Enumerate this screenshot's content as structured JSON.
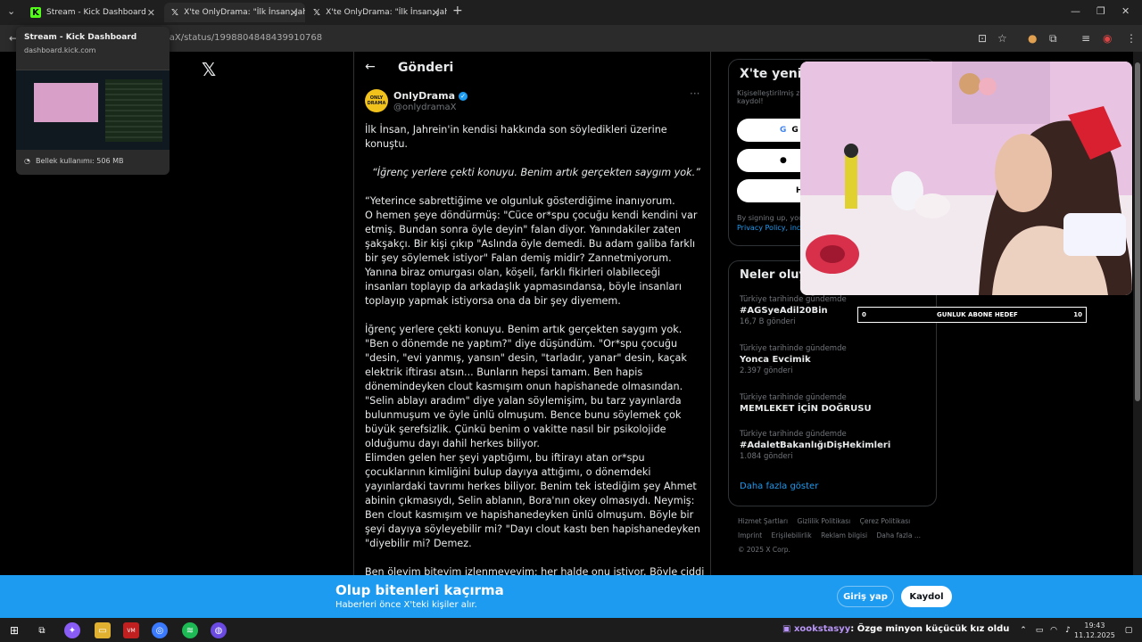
{
  "browser": {
    "tabs": [
      {
        "title": "Stream - Kick Dashboard",
        "icon": "kick-icon"
      },
      {
        "title": "X'te OnlyDrama: \"İlk İnsan, Jahr",
        "icon": "x-icon"
      },
      {
        "title": "X'te OnlyDrama: \"İlk İnsan, Jahr",
        "icon": "x-icon"
      }
    ],
    "url": "maX/status/1998804848439910768",
    "hover_card": {
      "title": "Stream - Kick Dashboard",
      "domain": "dashboard.kick.com",
      "memory": "Bellek kullanımı: 506 MB"
    }
  },
  "page": {
    "header_title": "Gönderi",
    "post": {
      "avatar_text": "ONLY DRAMA",
      "author": "OnlyDrama",
      "handle": "@onlydramaX",
      "intro": "İlk İnsan, Jahrein'in kendisi hakkında son söyledikleri üzerine konuştu.",
      "quote": "“İğrenç yerlere çekti konuyu. Benim artık gerçekten saygım yok.”",
      "para1": "“Yeterince sabrettiğime ve olgunluk gösterdiğime inanıyorum.\nO hemen şeye döndürmüş: \"Cüce or*spu çocuğu kendi kendini var etmiş. Bundan sonra öyle deyin\" falan diyor. Yanındakiler zaten şakşakçı. Bir kişi çıkıp \"Aslında öyle demedi. Bu adam galiba farklı bir şey söylemek istiyor\" Falan demiş midir? Zannetmiyorum. Yanına biraz omurgası olan, köşeli, farklı fikirleri olabileceği insanları toplayıp da arkadaşlık yapmasındansa, böyle insanları toplayıp yapmak istiyorsa ona da bir şey diyemem.",
      "para2": "İğrenç yerlere çekti konuyu. Benim artık gerçekten saygım yok. \"Ben o dönemde ne yaptım?\" diye düşündüm. \"Or*spu çocuğu \"desin, \"evi yanmış, yansın\" desin, \"tarladır, yanar\" desin, kaçak elektrik iftirası atsın... Bunların hepsi tamam. Ben hapis dönemindeyken clout kasmışım onun hapishanede olmasından. \"Selin ablayı aradım\" diye yalan söylemişim, bu tarz yayınlarda bulunmuşum ve öyle ünlü olmuşum. Bence bunu söylemek çok büyük şerefsizlik. Çünkü benim o vakitte nasıl bir psikolojide olduğumu dayı dahil herkes biliyor.\nElimden gelen her şeyi yaptığımı, bu iftirayı atan or*spu çocuklarının kimliğini bulup dayıya attığımı, o dönemdeki yayınlardaki tavrımı herkes biliyor. Benim tek istediğim şey Ahmet abinin çıkmasıydı, Selin ablanın, Bora'nın okey olmasıydı. Neymiş: Ben clout kasmışım ve hapishanedeyken ünlü olmuşum. Böyle bir şeyi dayıya söyleyebilir mi? \"Dayı clout kastı ben hapishanedeyken \"diyebilir mi? Demez.",
      "para3": "Ben öleyim biteyim izlenmeyeyim; her halde onu istiyor. Böyle ciddi bir problemin varsa ararsın. Sen şimdi hani \"abi-kardeş\" diyorsun ya, 40 küsur yaşında bir adam olarak ararsın. Söylediği şeylerin bazılarını yapmadım. Yaşanmamış şeyler. Ne hikmetse her yayın tekrarla tekrarla bunlar yavaş yavaş gerçeğe dönüşmeye başlıyor.”"
    },
    "signup": {
      "title": "X'te yeni mi",
      "subtitle": "Kişiselleştirilmiş z kaydol!",
      "google_label": "G",
      "apple_label": "",
      "create_label": "H",
      "legal": "By signing up, you",
      "legal_link": "Privacy Policy, inc"
    },
    "trends": {
      "title": "Neler oluyo",
      "items": [
        {
          "context": "Türkiye tarihinde gündemde",
          "name": "#AGSyeAdil20Bin",
          "count": "16,7 B gönderi"
        },
        {
          "context": "Türkiye tarihinde gündemde",
          "name": "Yonca Evcimik",
          "count": "2.397 gönderi"
        },
        {
          "context": "Türkiye tarihinde gündemde",
          "name": "MEMLEKET İÇİN DOĞRUSU",
          "count": ""
        },
        {
          "context": "Türkiye tarihinde gündemde",
          "name": "#AdaletBakanlığıDişHekimleri",
          "count": "1.084 gönderi"
        }
      ],
      "show_more": "Daha fazla göster"
    },
    "footer": [
      "Hizmet Şartları",
      "Gizlilik Politikası",
      "Çerez Politikası",
      "Imprint",
      "Erişilebilirlik",
      "Reklam bilgisi",
      "Daha fazla ...",
      "© 2025 X Corp."
    ]
  },
  "overlay": {
    "sub_goal": {
      "current": "0",
      "label": "GUNLUK ABONE HEDEF",
      "target": "10"
    }
  },
  "banner": {
    "title": "Olup bitenleri kaçırma",
    "subtitle": "Haberleri önce X'teki kişiler alır.",
    "login": "Giriş yap",
    "register": "Kaydol"
  },
  "taskbar": {
    "ticker_user": "xookstasyy",
    "ticker_text": ": Özge minyon küçücük kız oldu",
    "time": "19:43",
    "date": "11.12.2025"
  },
  "colors": {
    "accent": "#1d9bf0",
    "page_bg": "#000000",
    "muted": "#71767b"
  }
}
